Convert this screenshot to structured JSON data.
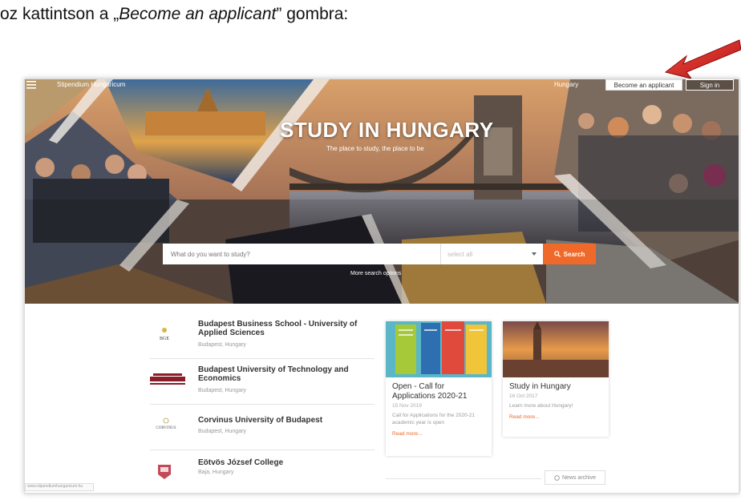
{
  "caption": {
    "prefix": "oz kattintson a „",
    "emph": "Become an applicant",
    "suffix": "” gombra:"
  },
  "header": {
    "brand": "Stipendium Hungaricum",
    "country": "Hungary",
    "become_applicant": "Become an applicant",
    "sign_in": "Sign in"
  },
  "hero": {
    "title": "STUDY IN HUNGARY",
    "subtitle": "The place to study, the place to be"
  },
  "search": {
    "placeholder": "What do you want to study?",
    "select_value": "select all",
    "button_label": "Search",
    "more_options": "More search options"
  },
  "universities": [
    {
      "name": "Budapest Business School - University of Applied Sciences",
      "location": "Budapest, Hungary",
      "logo": "BGE"
    },
    {
      "name": "Budapest University of Technology and Economics",
      "location": "Budapest, Hungary",
      "logo": ""
    },
    {
      "name": "Corvinus University of Budapest",
      "location": "Budapest, Hungary",
      "logo": "CORVINUS"
    },
    {
      "name": "Eötvös József College",
      "location": "Baja, Hungary",
      "logo": ""
    }
  ],
  "news": [
    {
      "title": "Open - Call for Applications 2020-21",
      "date": "15 Nov 2019",
      "desc": "Call for Applications for the 2020-21 academic year is open",
      "more": "Read more..."
    },
    {
      "title": "Study in Hungary",
      "date": "16 Oct 2017",
      "desc": "Learn more about Hungary!",
      "more": "Read more..."
    }
  ],
  "news_archive": "News archive",
  "status_url": "www.stipendiumhungaricum.hu",
  "colors": {
    "accent": "#ef6a2a",
    "arrow": "#d8262a"
  }
}
